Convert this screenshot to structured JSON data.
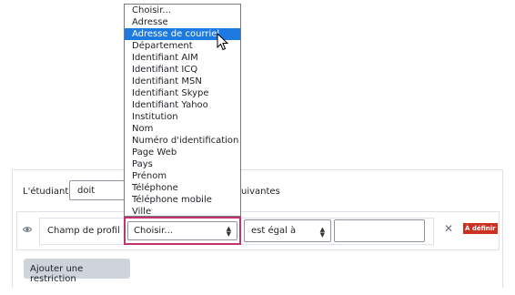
{
  "dropdown": {
    "options": [
      "Choisir...",
      "Adresse",
      "Adresse de courriel",
      "Département",
      "Identifiant AIM",
      "Identifiant ICQ",
      "Identifiant MSN",
      "Identifiant Skype",
      "Identifiant Yahoo",
      "Institution",
      "Nom",
      "Numéro d'identification",
      "Page Web",
      "Pays",
      "Prénom",
      "Téléphone",
      "Téléphone mobile",
      "Ville"
    ],
    "highlighted": "Adresse de courriel"
  },
  "restriction": {
    "student_label": "L'étudiant",
    "must_value": "doit",
    "following_text": "uivantes",
    "profile_label": "Champ de profil",
    "field_value": "Choisir...",
    "operator_value": "est égal à",
    "value_input": "",
    "undefined_badge": "À définir",
    "add_button": "Ajouter une restriction"
  },
  "icons": {
    "visibility": "eye-icon",
    "delete": "close-icon",
    "pointer": "mouse-cursor-icon"
  },
  "colors": {
    "focus_border": "#c4316f",
    "highlight": "#1e7ae0",
    "badge": "#ca3120"
  }
}
